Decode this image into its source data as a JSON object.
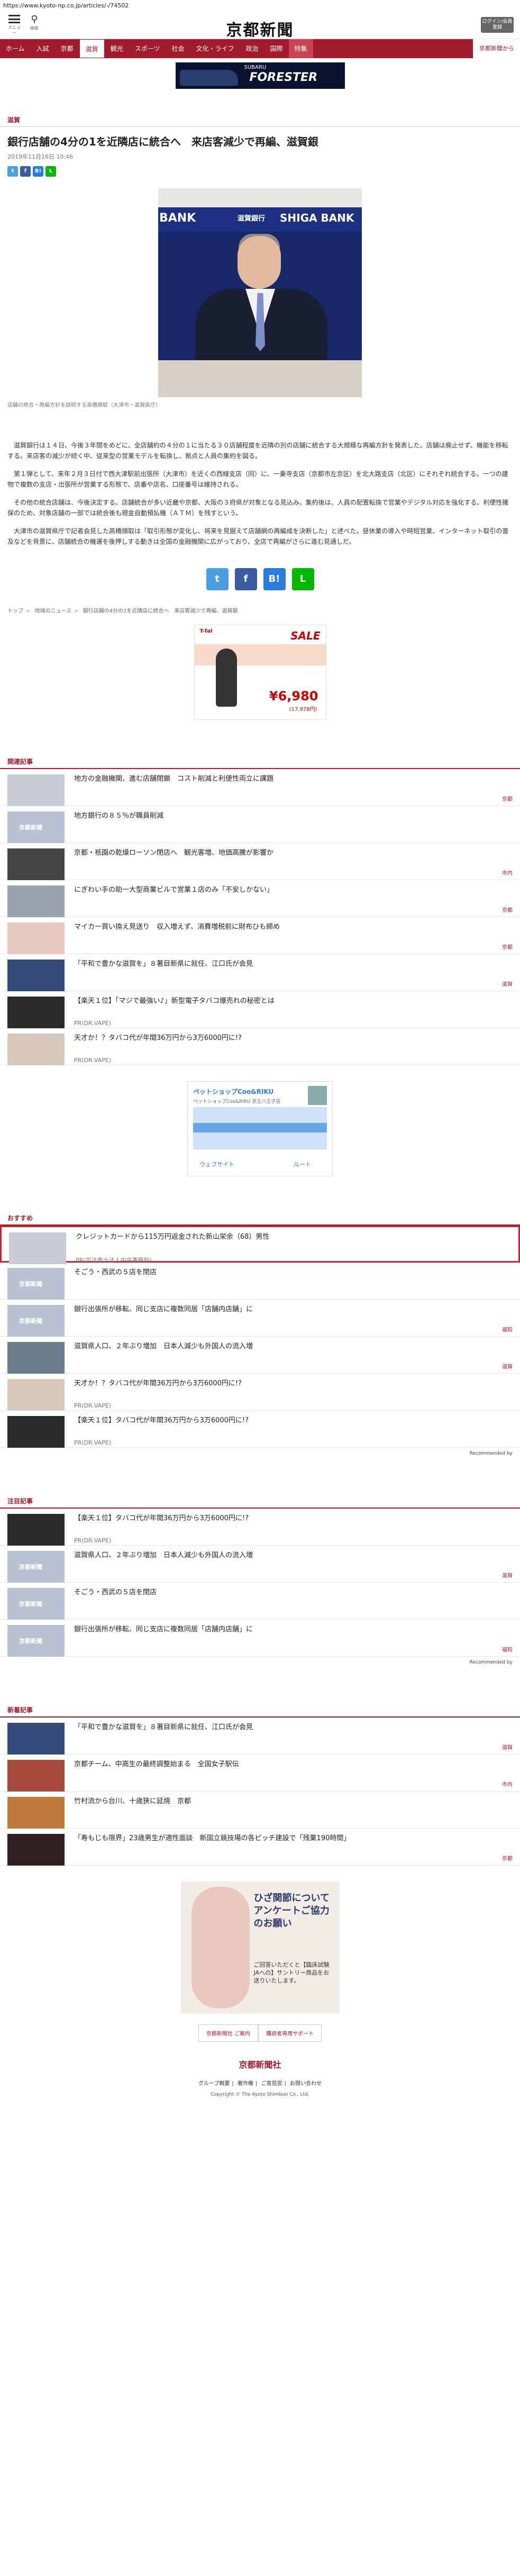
{
  "url": "https://www.kyoto-np.co.jp/articles/-/74502",
  "header": {
    "menu_label": "メニュー",
    "search_label": "検索",
    "logo": "京都新聞",
    "login_label": "ログイン/会員登録"
  },
  "nav": [
    "ホーム",
    "入試",
    "京都",
    "滋賀",
    "観光",
    "スポーツ",
    "社会",
    "文化・ライフ",
    "政治",
    "国際",
    "特集",
    "京都新聞から"
  ],
  "nav_active": "滋賀",
  "top_ad": {
    "brand": "SUBARU",
    "text": "FORESTER"
  },
  "article": {
    "section": "滋賀",
    "headline": "銀行店舗の4分の1を近隣店に統合へ　来店客減少で再編、滋賀銀",
    "date": "2019年11月16日 10:46",
    "photo": {
      "left": "BANK",
      "center": "滋賀銀行",
      "right": "SHIGA BANK"
    },
    "caption": "店舗の統合・再編方針を説明する高橋頭取（大津市・滋賀県庁）",
    "paragraphs": [
      "滋賀銀行は１４日、今後３年間をめどに、全店舗約の４分の１に当たる３０店舗程度を近隣の別の店舗に統合する大規模な再編方針を発表した。店舗は廃止せず、機能を移転する。来店客の減少が続く中、従来型の営業モデルを転換し、拠点と人員の集約を図る。",
      "第１弾として、来年２月３日付で西大津駅前出張所（大津市）を近くの西線支店（同）に、一乗寺支店（京都市左京区）を北大路支店（北区）にそれぞれ統合する。一つの建物で複数の支店・出張所が営業する形態で、店番や店名、口座番号は維持される。",
      "その他の統合店舗は、今後決定する。店舗統合が多い近畿や京都、大阪の３府県が対象となる見込み。集約後は、人員の配置転換で営業やデジタル対応を強化する。利便性確保のため、対象店舗の一部では統合後も現金自動預払機（ＡＴＭ）を残すという。",
      "大津市の滋賀県庁で記者会見した高橋頭取は「取引形態が変化し、将来を見据えて店舗網の再編成を決断した」と述べた。昼休業の導入や時短営業、インターネット取引の普及などを背景に、店舗統合の機運を後押しする動きは全国の金融機関に広がっており、全店で再編がさらに進む見通しだ。"
    ]
  },
  "breadcrumb": [
    "トップ",
    "地域のニュース",
    "銀行店舗の4分の1を近隣店に統合へ　来店客減少で再編、滋賀銀"
  ],
  "rect_ad": {
    "brand": "T-fal",
    "sale": "SALE",
    "price": "¥6,980",
    "sub": "(17,978円)"
  },
  "related": {
    "header": "関連記事",
    "items": [
      {
        "title": "地方の金融機関、進む店舗閉鎖　コスト削減と利便性両立に課題",
        "tag": "京都",
        "thumb": "th-news"
      },
      {
        "title": "地方銀行の８５％が職員削減",
        "tag": "",
        "thumb": "th-kyoto-logo"
      },
      {
        "title": "京都・祇園の乾燥ローソン閉店へ　観光客増、地価高騰が影響か",
        "tag": "市内",
        "thumb": "th-dark"
      },
      {
        "title": "にぎわい手の助一大型商業ビルで営業１店のみ「不安しかない」",
        "tag": "京都",
        "thumb": "th-street"
      },
      {
        "title": "マイカー買い換え見送り　収入増えず、消費増税前に財布ひも締め",
        "tag": "京都",
        "thumb": "th-pink"
      },
      {
        "title": "「平和で豊かな滋賀を」８著目新県に就任、江口氏が会見",
        "tag": "滋賀",
        "thumb": "th-portrait"
      },
      {
        "title": "【楽天１位】「マジで最強い♪」新型電子タバコ爆売れの秘密とは",
        "pr": "PR(DR.VAPE)",
        "thumb": "th-phone"
      },
      {
        "title": "天才か！？タバコ代が年間36万円から3万6000円に!?",
        "pr": "PR(DR.VAPE)",
        "thumb": "th-woman"
      }
    ]
  },
  "map_ad": {
    "title": "ペットショップCoo&RIKU",
    "sub": "ペットショップCoo&RIKU 京王八王子店",
    "btn_web": "ウェブサイト",
    "btn_route": "ルート"
  },
  "recommend": {
    "header": "おすすめ",
    "items": [
      {
        "title": "クレジットカードから115万円返金された新山栄余（68）男性",
        "pr": "PR(司法書士法人中央事務所)",
        "thumb": "th-news",
        "highlight": true
      },
      {
        "title": "そごう・西武の５店を閉店",
        "tag": "",
        "thumb": "th-kyoto-logo"
      },
      {
        "title": "銀行出張所が移転、同じ支店に複数同居「店舗内店舗」に",
        "tag": "福知",
        "thumb": "th-kyoto-logo"
      },
      {
        "title": "滋賀県人口、２年ぶり増加　日本人減少も外国人の流入増",
        "tag": "滋賀",
        "thumb": "th-bridge"
      },
      {
        "title": "天才か！？タバコ代が年間36万円から3万6000円に!?",
        "pr": "PR(DR.VAPE)",
        "thumb": "th-woman"
      },
      {
        "title": "【楽天１位】タバコ代が年間36万円から3万6000円に!?",
        "pr": "PR(DR.VAPE)",
        "thumb": "th-phone"
      }
    ],
    "powered": "Recommended by"
  },
  "featured": {
    "header": "注目記事",
    "items": [
      {
        "title": "【楽天１位】タバコ代が年間36万円から3万6000円に!?",
        "pr": "PR(DR.VAPE)",
        "thumb": "th-phone"
      },
      {
        "title": "滋賀県人口、２年ぶり増加　日本人減少も外国人の流入増",
        "tag": "滋賀",
        "thumb": "th-kyoto-logo"
      },
      {
        "title": "そごう・西武の５店を閉店",
        "tag": "",
        "thumb": "th-kyoto-logo"
      },
      {
        "title": "銀行出張所が移転、同じ支店に複数同居「店舗内店舗」に",
        "tag": "福知",
        "thumb": "th-kyoto-logo"
      }
    ],
    "powered": "Recommended by"
  },
  "latest": {
    "header": "新着記事",
    "items": [
      {
        "title": "「平和で豊かな滋賀を」８著目新県に就任、江口氏が会見",
        "tag": "滋賀",
        "thumb": "th-portrait"
      },
      {
        "title": "京都チーム、中高生の最終調整始まる　全国女子駅伝",
        "tag": "市内",
        "thumb": "th-red"
      },
      {
        "title": "竹村流から台川、十歳狭に延焼　京都",
        "tag": "",
        "thumb": "th-orange"
      },
      {
        "title": "「寿もじも限界」23歳男生が適性面談　新国立競技場の各ピッチ建設で「残業190時間」",
        "tag": "京都",
        "thumb": "th-fire"
      }
    ]
  },
  "bottom_ad": {
    "title": "ひざ関節についてアンケートご協力のお願い",
    "sub": "ご回答いただくと【臨床試験JAへの】サントリー商品をお送りいたします。"
  },
  "footer": {
    "links": [
      "京都新聞社 ご案内",
      "購読者専用サポート"
    ],
    "logo": "京都新聞社",
    "meta": [
      "グループ概要",
      "著作権",
      "ご意見窓",
      "お問い合わせ"
    ],
    "copyright": "Copyright © The Kyoto Shimbun Co., Ltd."
  }
}
